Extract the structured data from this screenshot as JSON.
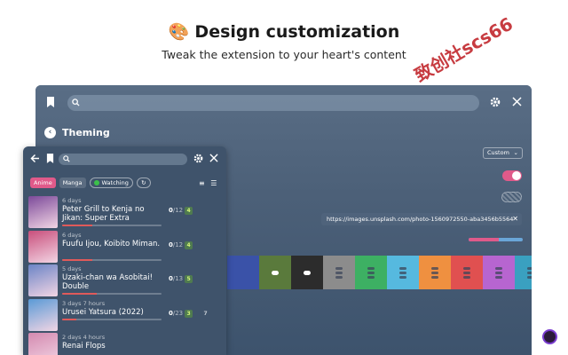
{
  "heading": {
    "emoji": "🎨",
    "title": "Design customization",
    "subtitle": "Tweak the extension to your heart's content"
  },
  "watermark": "致创社scs66",
  "back_window": {
    "icons": {
      "bookmark": "bookmark-icon",
      "search": "search-icon",
      "gear": "gear-icon",
      "close": "close-icon"
    },
    "section_label": "Theming",
    "select_value": "Custom",
    "toggle_on": true,
    "background_url": "https://images.unsplash.com/photo-1560972550-aba3456b5564",
    "slider_value": 0.55,
    "swatches": [
      {
        "color": "#3a52a8",
        "style": "none"
      },
      {
        "color": "#5a7a3c",
        "style": "pill"
      },
      {
        "color": "#2c2c2c",
        "style": "pill"
      },
      {
        "color": "#8c8c8c",
        "style": "bars"
      },
      {
        "color": "#3db063",
        "style": "bars"
      },
      {
        "color": "#56b9df",
        "style": "bars"
      },
      {
        "color": "#ef9040",
        "style": "bars"
      },
      {
        "color": "#e05050",
        "style": "bars"
      },
      {
        "color": "#b765d0",
        "style": "bars"
      },
      {
        "color": "#3aa0c0",
        "style": "bars"
      }
    ]
  },
  "popup": {
    "filters": {
      "anime": "Anime",
      "manga": "Manga",
      "watching": "Watching"
    },
    "items": [
      {
        "days": "6 days",
        "title": "Peter Grill to Kenja no Jikan: Super Extra",
        "progress": "0",
        "total": "/12",
        "badge": "4",
        "bar": 0.3,
        "thumb": "#7c4a9a"
      },
      {
        "days": "6 days",
        "title": "Fuufu Ijou, Koibito Miman.",
        "progress": "0",
        "total": "/12",
        "badge": "4",
        "bar": 0.3,
        "thumb": "#c94f7c"
      },
      {
        "days": "5 days",
        "title": "Uzaki-chan wa Asobitai! Double",
        "progress": "0",
        "total": "/13",
        "badge": "5",
        "bar": 0.35,
        "thumb": "#6b84c6"
      },
      {
        "days": "3 days 7 hours",
        "title": "Urusei Yatsura (2022)",
        "progress": "0",
        "total": "/23",
        "badge": "3",
        "extra": "7",
        "bar": 0.14,
        "thumb": "#5a9ad6"
      },
      {
        "days": "2 days 4 hours",
        "title": "Renai Flops",
        "progress": "",
        "total": "",
        "badge": "",
        "bar": 0,
        "thumb": "#d48ab0"
      }
    ]
  }
}
